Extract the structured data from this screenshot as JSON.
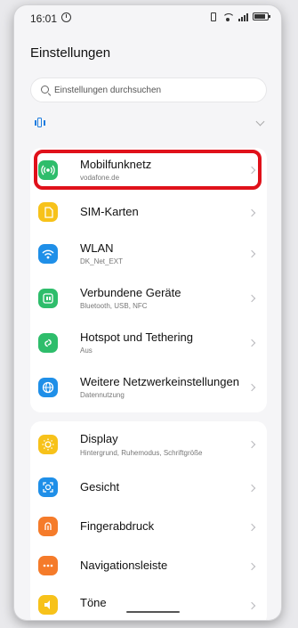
{
  "status_bar": {
    "time": "16:01"
  },
  "header": {
    "title": "Einstellungen"
  },
  "search": {
    "placeholder": "Einstellungen durchsuchen"
  },
  "network_section": {
    "items": [
      {
        "label": "Mobilfunknetz",
        "sub": "vodafone.de",
        "icon": "cellular-icon",
        "color": "#2ebd6b"
      },
      {
        "label": "SIM-Karten",
        "sub": "",
        "icon": "sim-card-icon",
        "color": "#f7c21a"
      },
      {
        "label": "WLAN",
        "sub": "DK_Net_EXT",
        "icon": "wifi-icon",
        "color": "#1f8fe8"
      },
      {
        "label": "Verbundene Geräte",
        "sub": "Bluetooth, USB, NFC",
        "icon": "connected-devices-icon",
        "color": "#2ebd6b"
      },
      {
        "label": "Hotspot und Tethering",
        "sub": "Aus",
        "icon": "hotspot-icon",
        "color": "#2ebd6b"
      },
      {
        "label": "Weitere Netzwerkeinstellungen",
        "sub": "Datennutzung",
        "icon": "globe-icon",
        "color": "#1f8fe8"
      }
    ]
  },
  "device_section": {
    "items": [
      {
        "label": "Display",
        "sub": "Hintergrund, Ruhemodus, Schriftgröße",
        "icon": "display-icon",
        "color": "#f7c21a"
      },
      {
        "label": "Gesicht",
        "sub": "",
        "icon": "face-icon",
        "color": "#1f8fe8"
      },
      {
        "label": "Fingerabdruck",
        "sub": "",
        "icon": "fingerprint-icon",
        "color": "#f57b2a"
      },
      {
        "label": "Navigationsleiste",
        "sub": "",
        "icon": "navigation-bar-icon",
        "color": "#f57b2a"
      },
      {
        "label": "Töne",
        "sub": "",
        "icon": "sound-icon",
        "color": "#f7c21a"
      }
    ]
  },
  "colors": {
    "highlight": "#e0111a",
    "accent": "#1b7bdf"
  }
}
